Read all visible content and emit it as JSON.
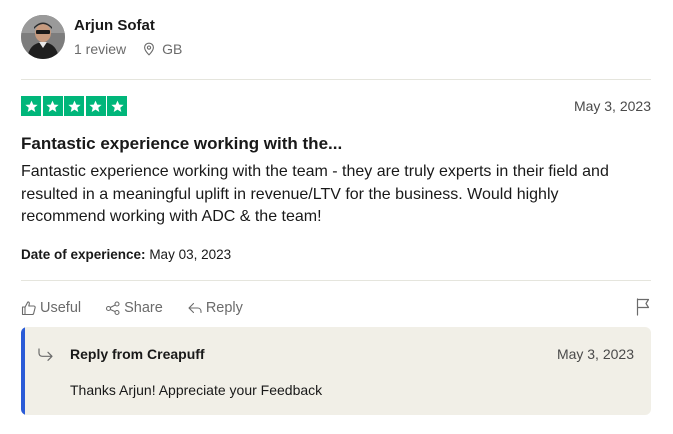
{
  "reviewer": {
    "name": "Arjun Sofat",
    "review_count": "1 review",
    "country": "GB"
  },
  "review": {
    "rating": 5,
    "max_rating": 5,
    "star_color": "#00b67a",
    "date": "May 3, 2023",
    "title": "Fantastic experience working with the...",
    "body": "Fantastic experience working with the team - they are truly experts in their field and resulted in a meaningful uplift in revenue/LTV for the business. Would highly recommend working with ADC & the team!",
    "experience_label": "Date of experience:",
    "experience_date": "May 03, 2023"
  },
  "actions": {
    "useful": "Useful",
    "share": "Share",
    "reply": "Reply"
  },
  "reply": {
    "from": "Reply from Creapuff",
    "date": "May 3, 2023",
    "text": "Thanks Arjun! Appreciate your Feedback",
    "accent_color": "#2a5bd7"
  },
  "icons": {
    "location": "map-pin-icon",
    "useful": "thumbs-up-icon",
    "share": "share-icon",
    "reply": "reply-arrow-icon",
    "report": "flag-icon"
  }
}
